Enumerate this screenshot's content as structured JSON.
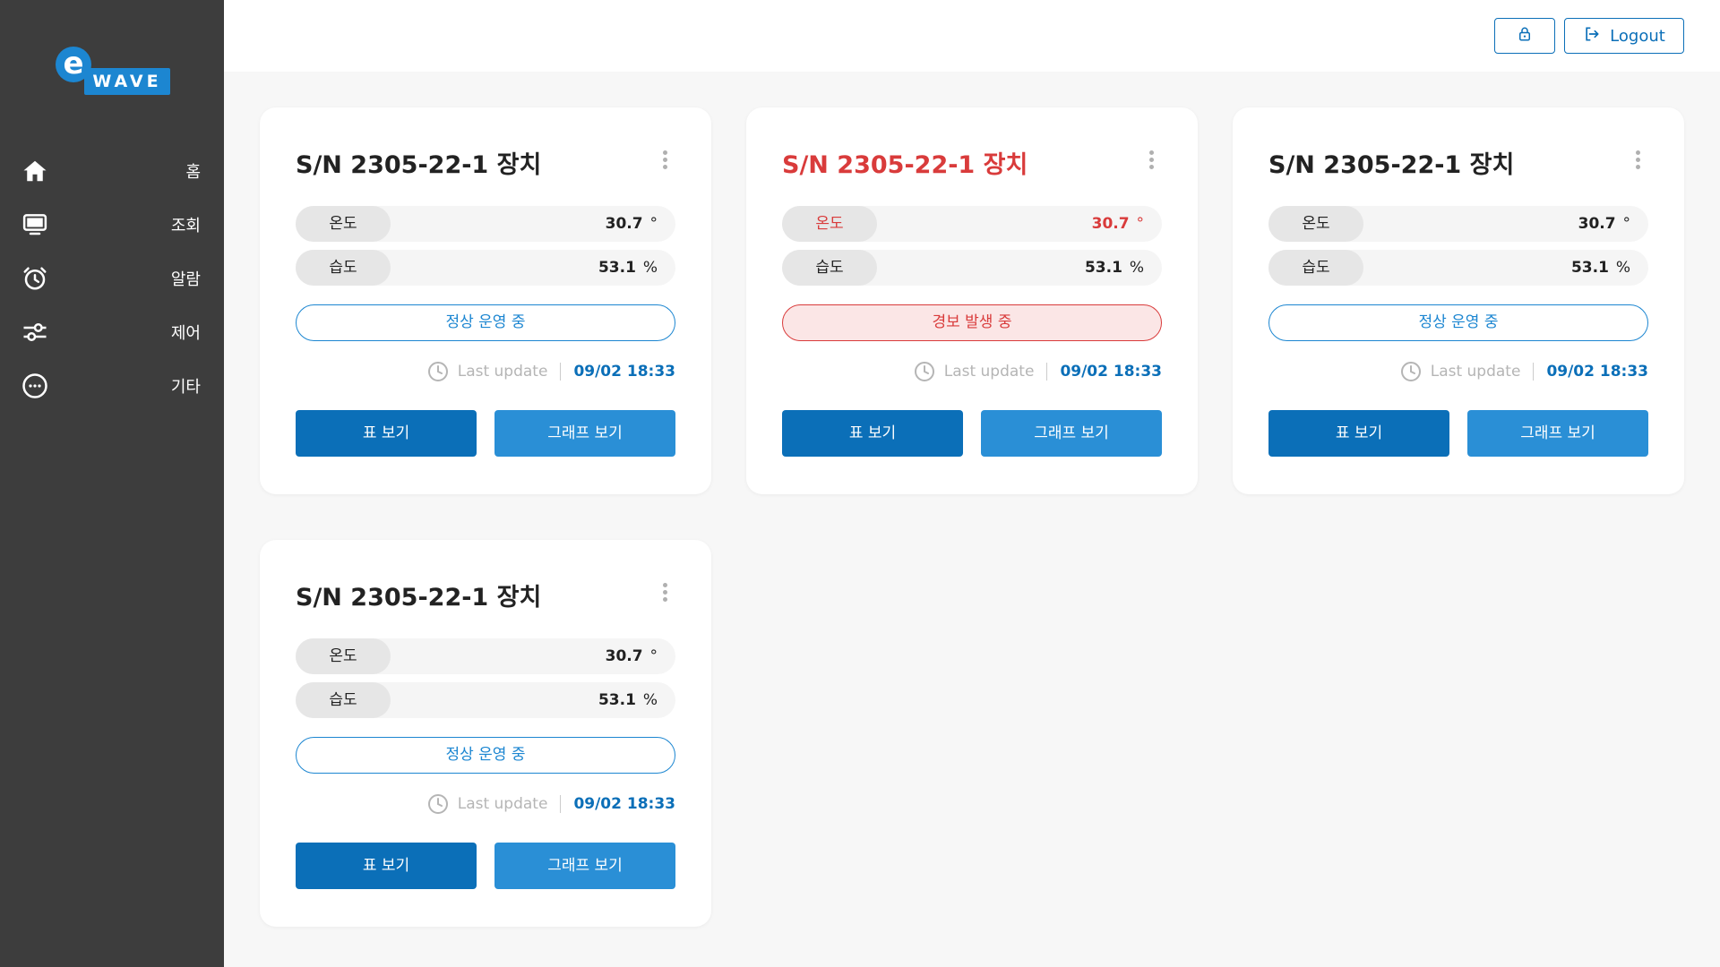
{
  "brand": {
    "letter": "e",
    "name": "WAVE"
  },
  "sidebar": {
    "items": [
      {
        "label": "홈",
        "icon": "home-icon"
      },
      {
        "label": "조회",
        "icon": "monitor-icon"
      },
      {
        "label": "알람",
        "icon": "alarm-clock-icon"
      },
      {
        "label": "제어",
        "icon": "sliders-icon"
      },
      {
        "label": "기타",
        "icon": "more-circle-icon"
      }
    ]
  },
  "header": {
    "lock_icon": "lock-icon",
    "logout_icon": "logout-icon",
    "logout_label": "Logout"
  },
  "colors": {
    "sidebar": "#3d3d3d",
    "primary": "#0b6fb8",
    "accent": "#2a8fd6",
    "alarm": "#d93b3b"
  },
  "devices": [
    {
      "title": "S/N 2305-22-1 장치",
      "temp_label": "온도",
      "temp_value": "30.7",
      "temp_unit": "°",
      "hum_label": "습도",
      "hum_value": "53.1",
      "hum_unit": "%",
      "status": "정상 운영 중",
      "update_label": "Last update",
      "update_time": "09/02 18:33",
      "table_btn": "표 보기",
      "graph_btn": "그래프 보기",
      "state": "normal"
    },
    {
      "title": "S/N 2305-22-1 장치",
      "temp_label": "온도",
      "temp_value": "30.7",
      "temp_unit": "°",
      "hum_label": "습도",
      "hum_value": "53.1",
      "hum_unit": "%",
      "status": "경보 발생 중",
      "update_label": "Last update",
      "update_time": "09/02 18:33",
      "table_btn": "표 보기",
      "graph_btn": "그래프 보기",
      "state": "alarm"
    },
    {
      "title": "S/N 2305-22-1 장치",
      "temp_label": "온도",
      "temp_value": "30.7",
      "temp_unit": "°",
      "hum_label": "습도",
      "hum_value": "53.1",
      "hum_unit": "%",
      "status": "정상 운영 중",
      "update_label": "Last update",
      "update_time": "09/02 18:33",
      "table_btn": "표 보기",
      "graph_btn": "그래프 보기",
      "state": "normal"
    },
    {
      "title": "S/N 2305-22-1 장치",
      "temp_label": "온도",
      "temp_value": "30.7",
      "temp_unit": "°",
      "hum_label": "습도",
      "hum_value": "53.1",
      "hum_unit": "%",
      "status": "정상 운영 중",
      "update_label": "Last update",
      "update_time": "09/02 18:33",
      "table_btn": "표 보기",
      "graph_btn": "그래프 보기",
      "state": "normal"
    }
  ]
}
